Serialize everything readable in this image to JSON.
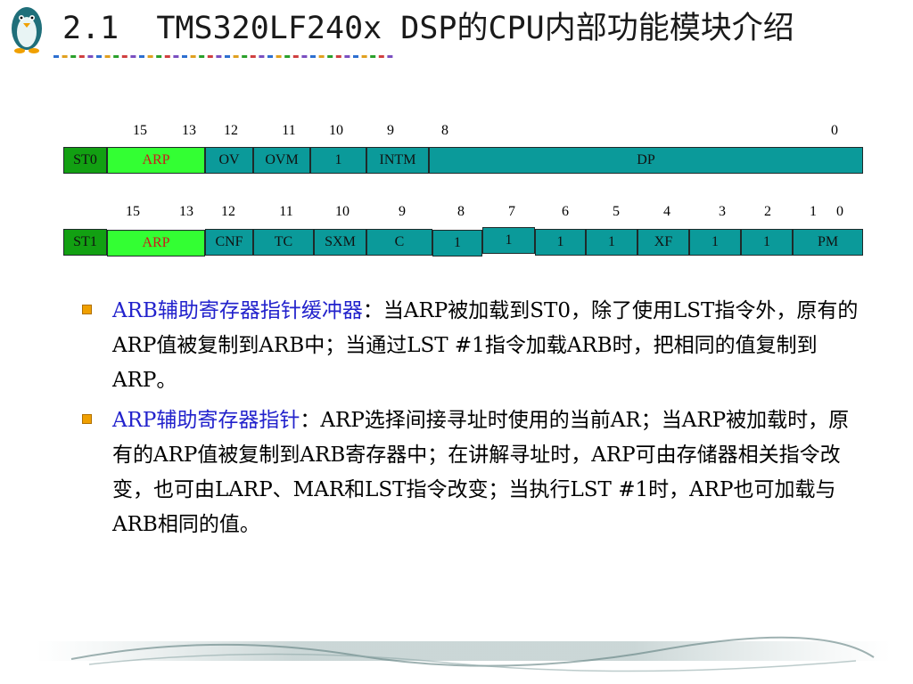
{
  "slide": {
    "title": "2.1  TMS320LF240x DSP的CPU内部功能模块介绍"
  },
  "colors": {
    "teal": "#0b9a9a",
    "green": "#12a012",
    "lime": "#33ff33",
    "arp_text": "#cc1a1a",
    "term_blue": "#2222cc",
    "bullet_orange": "#f0a000"
  },
  "st0": {
    "bits": [
      "15",
      "13",
      "12",
      "11",
      "10",
      "9",
      "8",
      "0"
    ],
    "fields": [
      "ST0",
      "ARP",
      "OV",
      "OVM",
      "1",
      "INTM",
      "DP"
    ]
  },
  "st1": {
    "bits": [
      "15",
      "13",
      "12",
      "11",
      "10",
      "9",
      "8",
      "7",
      "6",
      "5",
      "4",
      "3",
      "2",
      "1",
      "0"
    ],
    "fields": [
      "ST1",
      "ARP",
      "CNF",
      "TC",
      "SXM",
      "C",
      "1",
      "1",
      "1",
      "1",
      "XF",
      "1",
      "1",
      "PM"
    ]
  },
  "bullets": [
    {
      "term": "ARB辅助寄存器指针缓冲器",
      "text": "：当ARP被加载到ST0，除了使用LST指令外，原有的ARP值被复制到ARB中；当通过LST  #1指令加载ARB时，把相同的值复制到ARP。"
    },
    {
      "term": "ARP辅助寄存器指针",
      "text": "：ARP选择间接寻址时使用的当前AR；当ARP被加载时，原有的ARP值被复制到ARB寄存器中；在讲解寻址时，ARP可由存储器相关指令改变，也可由LARP、MAR和LST指令改变；当执行LST  #1时，ARP也可加载与ARB相同的值。"
    }
  ]
}
